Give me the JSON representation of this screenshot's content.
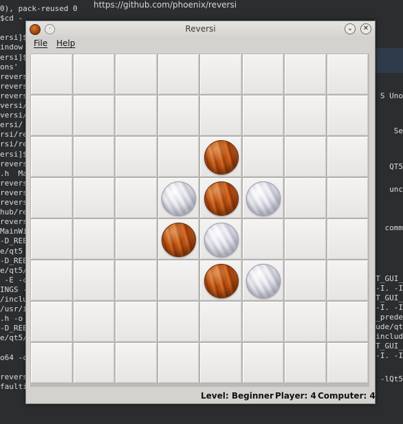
{
  "terminal": {
    "url_text": "https://github.com/phoenix/reversi",
    "lines_left": [
      "0), pack-reused 0",
      "$cd -",
      "",
      "ersi]$",
      "indow",
      "ersi]$",
      "ons'",
      "revers",
      "revers",
      "revers",
      "versi/",
      "versi/",
      "ersi/",
      "rsi/re",
      "rsi/re",
      "ersi]$",
      "revers",
      ".h  Ma",
      "revers",
      "revers",
      "revers",
      "hub/re",
      "revers",
      "MainWi",
      "-D_REE",
      "e/qt5",
      "-D_REE",
      "e/qt5/",
      " -E -c",
      "INGS -",
      "/inclu",
      "/usr/i",
      ".h -o",
      "-D_REE",
      "e/qt5/",
      "",
      "o64 -c",
      "",
      "revers",
      "faulting to '/tmp/runtime-phoenix'"
    ],
    "lines_right": [
      "S Uno",
      "Se",
      "QT5",
      "unc",
      "comm",
      "T_GUI_",
      "-I. -I",
      "T_GUI_",
      "-I. -I",
      "_prede",
      "ude/qt",
      "includ",
      "T_GUI_",
      "-I. -I",
      "-lQt5"
    ]
  },
  "window": {
    "title": "Reversi",
    "menu_button_glyph": "·",
    "minimize_glyph": "⌄",
    "close_glyph": "✕",
    "app_icon": "reversi-piece-icon"
  },
  "menu": {
    "file": "File",
    "help": "Help"
  },
  "board": {
    "rows": 8,
    "cols": 8,
    "pieces": [
      {
        "row": 2,
        "col": 4,
        "color": "computer"
      },
      {
        "row": 3,
        "col": 3,
        "color": "player"
      },
      {
        "row": 3,
        "col": 4,
        "color": "computer"
      },
      {
        "row": 3,
        "col": 5,
        "color": "player"
      },
      {
        "row": 4,
        "col": 3,
        "color": "computer"
      },
      {
        "row": 4,
        "col": 4,
        "color": "player"
      },
      {
        "row": 5,
        "col": 4,
        "color": "computer"
      },
      {
        "row": 5,
        "col": 5,
        "color": "player"
      }
    ]
  },
  "status": {
    "level": "Level: Beginner",
    "player": "Player: 4",
    "computer": "Computer: 4"
  }
}
